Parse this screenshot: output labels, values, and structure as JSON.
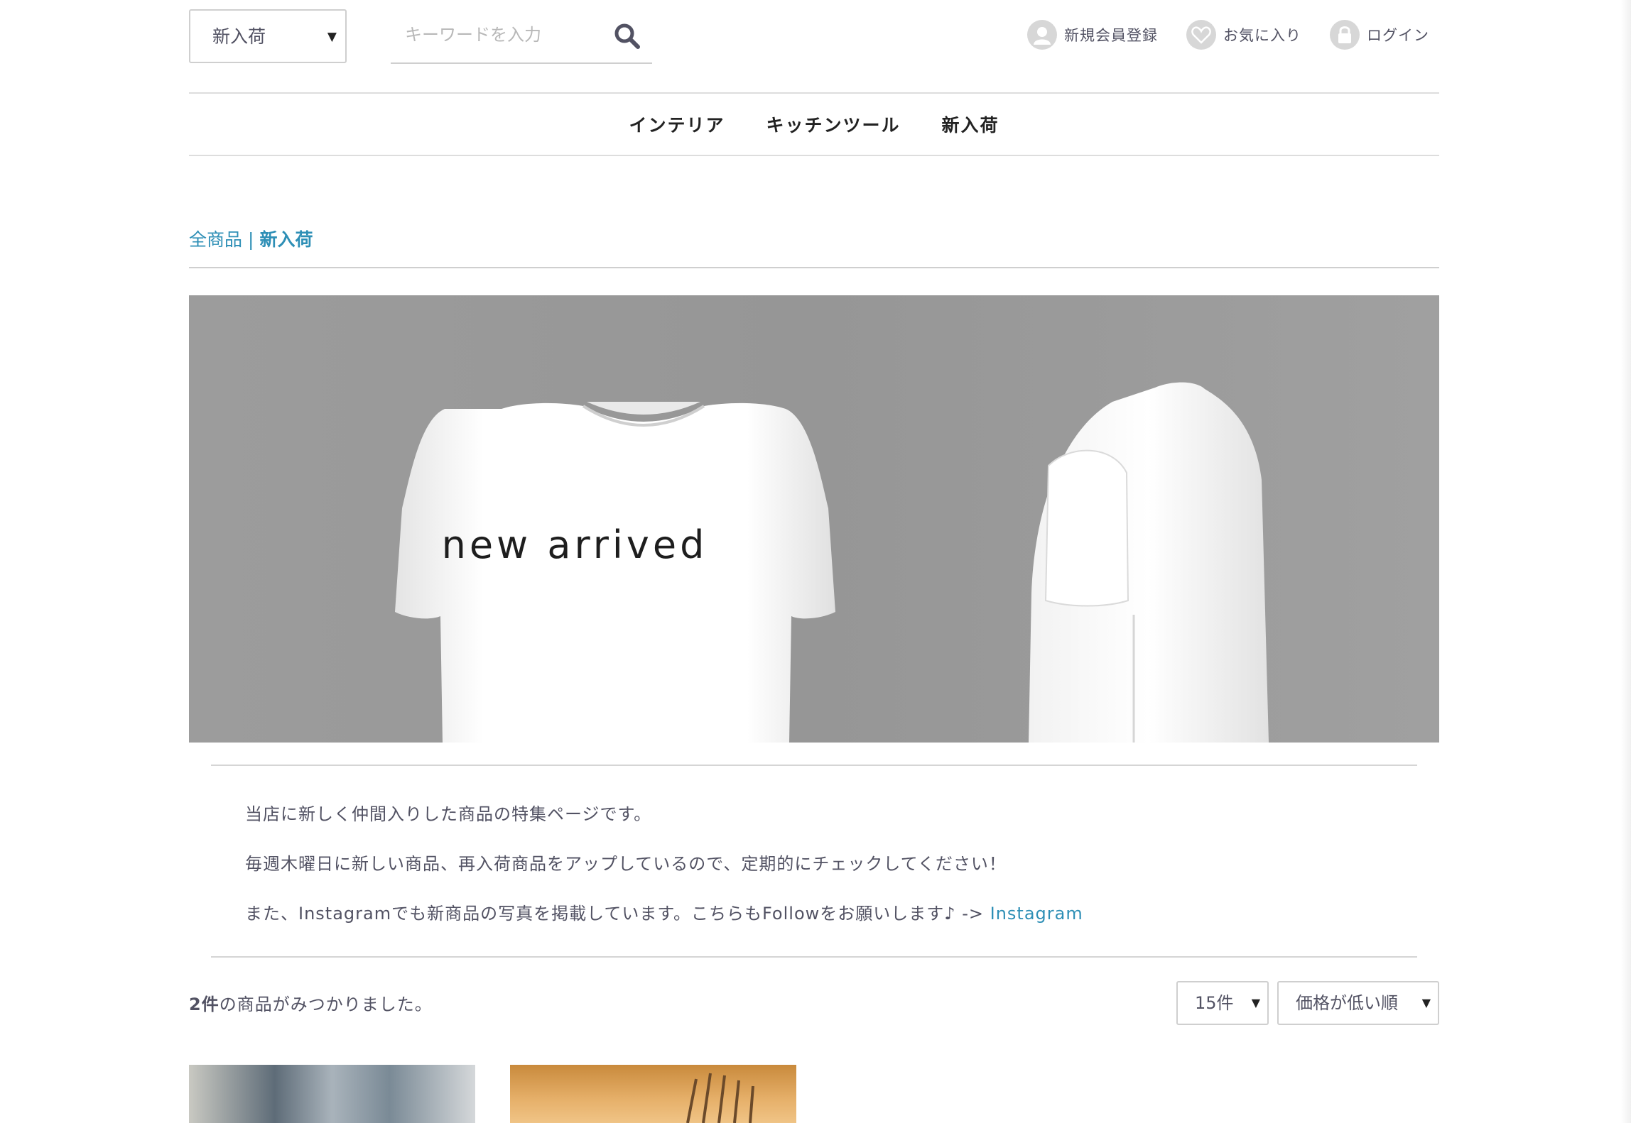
{
  "header": {
    "category_select": "新入荷",
    "search_placeholder": "キーワードを入力",
    "user_nav": {
      "register": "新規会員登録",
      "favorites": "お気に入り",
      "login": "ログイン"
    }
  },
  "category_nav": [
    "インテリア",
    "キッチンツール",
    "新入荷"
  ],
  "breadcrumb": {
    "root": "全商品",
    "separator": "|",
    "current": "新入荷"
  },
  "banner": {
    "text": "new arrived"
  },
  "description": {
    "line1": "当店に新しく仲間入りした商品の特集ページです。",
    "line2": "毎週木曜日に新しい商品、再入荷商品をアップしているので、定期的にチェックしてください！",
    "line3_prefix": "また、Instagramでも新商品の写真を掲載しています。こちらもFollowをお願いします♪ ->",
    "line3_link": "Instagram"
  },
  "results": {
    "count": "2件",
    "suffix": "の商品がみつかりました。",
    "per_page": "15件",
    "order": "価格が低い順"
  },
  "colors": {
    "accent_link": "#2e8fb6",
    "text": "#525263",
    "banner_bg": "#9a9a9a"
  }
}
